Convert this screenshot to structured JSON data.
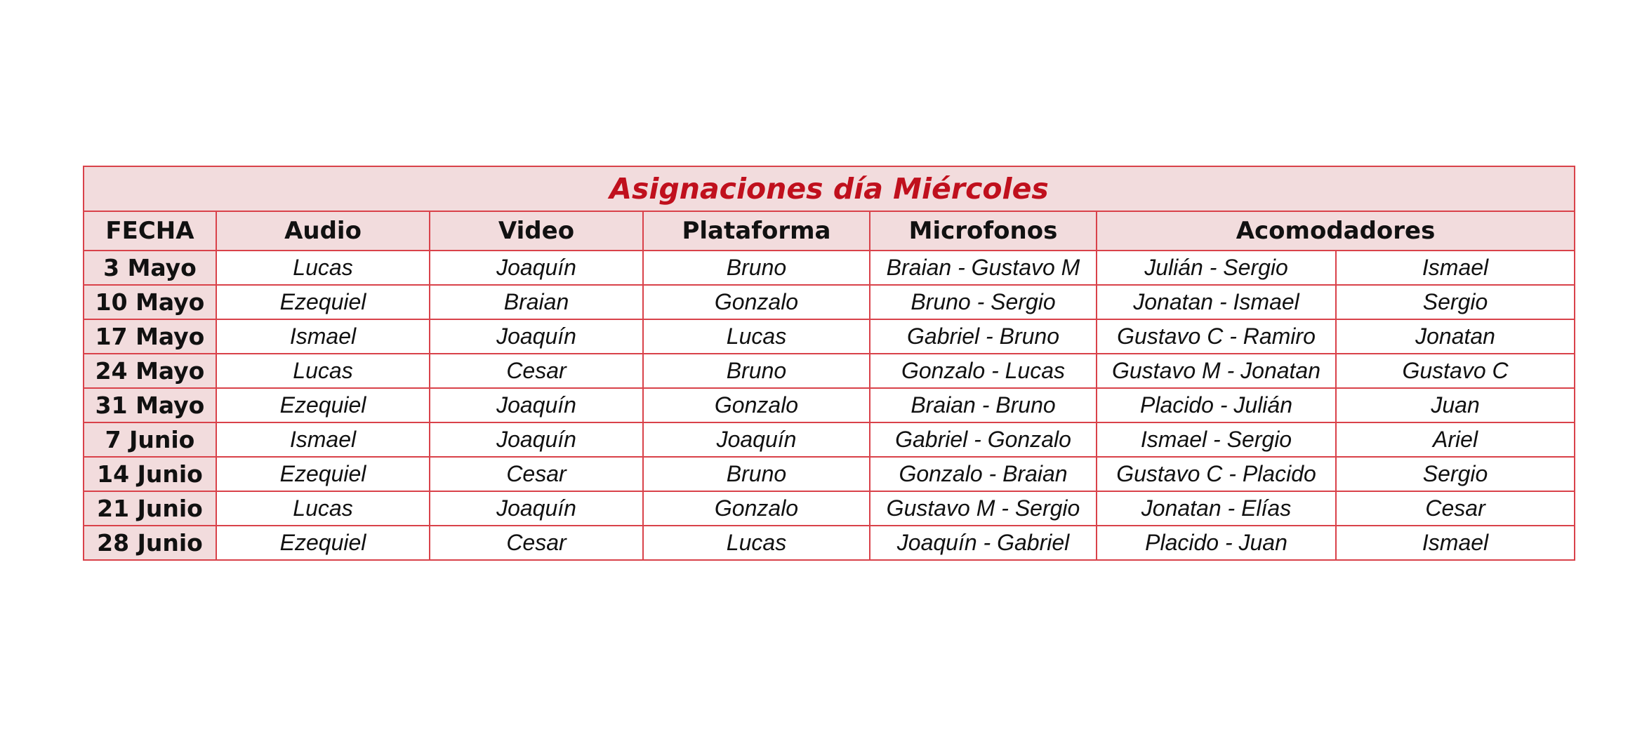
{
  "title": "Asignaciones día Miércoles",
  "headers": {
    "fecha": "FECHA",
    "audio": "Audio",
    "video": "Video",
    "plataforma": "Plataforma",
    "microfonos": "Microfonos",
    "acomodadores": "Acomodadores"
  },
  "rows": [
    {
      "fecha": "3 Mayo",
      "audio": "Lucas",
      "video": "Joaquín",
      "plataforma": "Bruno",
      "microfonos": "Braian - Gustavo M",
      "acomodador_1": "Julián - Sergio",
      "acomodador_2": "Ismael"
    },
    {
      "fecha": "10 Mayo",
      "audio": "Ezequiel",
      "video": "Braian",
      "plataforma": "Gonzalo",
      "microfonos": "Bruno - Sergio",
      "acomodador_1": "Jonatan - Ismael",
      "acomodador_2": "Sergio"
    },
    {
      "fecha": "17 Mayo",
      "audio": "Ismael",
      "video": "Joaquín",
      "plataforma": "Lucas",
      "microfonos": "Gabriel - Bruno",
      "acomodador_1": "Gustavo C - Ramiro",
      "acomodador_2": "Jonatan"
    },
    {
      "fecha": "24 Mayo",
      "audio": "Lucas",
      "video": "Cesar",
      "plataforma": "Bruno",
      "microfonos": "Gonzalo - Lucas",
      "acomodador_1": "Gustavo M - Jonatan",
      "acomodador_2": "Gustavo C"
    },
    {
      "fecha": "31 Mayo",
      "audio": "Ezequiel",
      "video": "Joaquín",
      "plataforma": "Gonzalo",
      "microfonos": "Braian - Bruno",
      "acomodador_1": "Placido - Julián",
      "acomodador_2": "Juan"
    },
    {
      "fecha": "7 Junio",
      "audio": "Ismael",
      "video": "Joaquín",
      "plataforma": "Joaquín",
      "microfonos": "Gabriel - Gonzalo",
      "acomodador_1": "Ismael - Sergio",
      "acomodador_2": "Ariel"
    },
    {
      "fecha": "14 Junio",
      "audio": "Ezequiel",
      "video": "Cesar",
      "plataforma": "Bruno",
      "microfonos": "Gonzalo - Braian",
      "acomodador_1": "Gustavo C - Placido",
      "acomodador_2": "Sergio"
    },
    {
      "fecha": "21 Junio",
      "audio": "Lucas",
      "video": "Joaquín",
      "plataforma": "Gonzalo",
      "microfonos": "Gustavo M - Sergio",
      "acomodador_1": "Jonatan - Elías",
      "acomodador_2": "Cesar"
    },
    {
      "fecha": "28 Junio",
      "audio": "Ezequiel",
      "video": "Cesar",
      "plataforma": "Lucas",
      "microfonos": "Joaquín - Gabriel",
      "acomodador_1": "Placido - Juan",
      "acomodador_2": "Ismael"
    }
  ],
  "colors": {
    "title_text": "#c0101d",
    "header_fill": "#f2dcdd",
    "border": "#d9424a"
  }
}
